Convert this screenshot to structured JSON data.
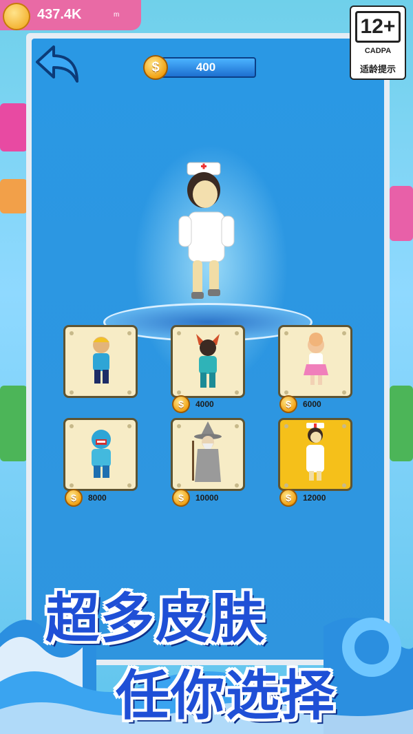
{
  "header": {
    "score": "437.4K",
    "score_suffix": "m"
  },
  "coins": {
    "icon": "coin-icon",
    "symbol": "$",
    "balance": "400"
  },
  "age_rating": {
    "label": "12+",
    "org": "CADPA",
    "tip": "适龄提示"
  },
  "preview": {
    "character": "nurse",
    "platform": "teleport-pad"
  },
  "skins": [
    {
      "id": "basic",
      "figure": "boy-blue-shirt",
      "price": ""
    },
    {
      "id": "warrior",
      "figure": "horned-armor-girl",
      "price": "4000"
    },
    {
      "id": "dancer",
      "figure": "pink-dress-girl",
      "price": "6000"
    },
    {
      "id": "monster",
      "figure": "teeth-mask-hoodie",
      "price": "8000"
    },
    {
      "id": "wizard",
      "figure": "grey-wizard",
      "price": "10000"
    },
    {
      "id": "nurse",
      "figure": "nurse",
      "price": "12000",
      "selected": true
    }
  ],
  "promo": {
    "line1": "超多皮肤",
    "line2": "任你选择"
  },
  "colors": {
    "panel": "#2f95df",
    "card": "#f7ecc6",
    "card_selected": "#f5c01a",
    "headline": "#1f4fd6"
  }
}
